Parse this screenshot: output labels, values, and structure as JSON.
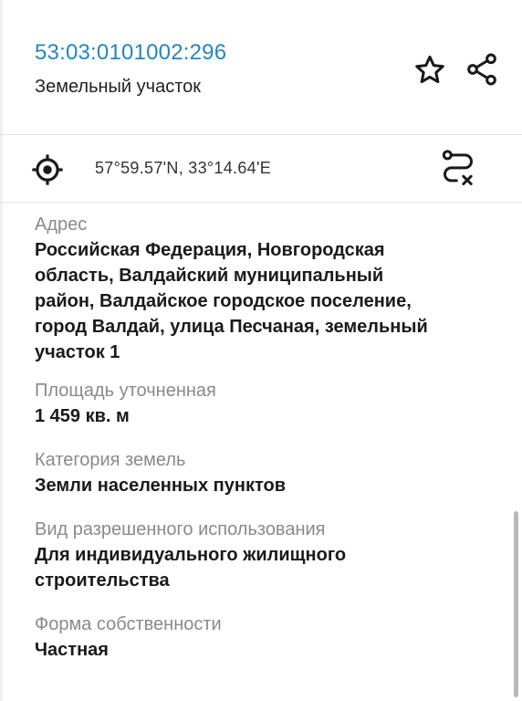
{
  "header": {
    "cadastral_number": "53:03:0101002:296",
    "object_type": "Земельный участок"
  },
  "icons": {
    "favorite": "star-icon",
    "share": "share-icon",
    "locate": "crosshair-icon",
    "route": "route-icon"
  },
  "location": {
    "coordinates": "57°59.57'N, 33°14.64'E"
  },
  "fields": {
    "address": {
      "label": "Адрес",
      "value_lines": [
        "Российская Федерация, Новгородская",
        "область, Валдайский муниципальный",
        "район, Валдайское городское поселение,",
        "город Валдай, улица Песчаная, земельный",
        "участок 1"
      ]
    },
    "area": {
      "label": "Площадь уточненная",
      "value": "1 459 кв. м"
    },
    "category": {
      "label": "Категория земель",
      "value": "Земли населенных пунктов"
    },
    "permitted_use": {
      "label": "Вид разрешенного использования",
      "value_lines": [
        "Для индивидуального жилищного",
        "строительства"
      ]
    },
    "ownership": {
      "label": "Форма собственности",
      "value": "Частная"
    }
  },
  "colors": {
    "accent": "#2387c0",
    "label": "#8a8a8a",
    "text": "#1a1a1a",
    "divider": "#e3e3e3"
  }
}
